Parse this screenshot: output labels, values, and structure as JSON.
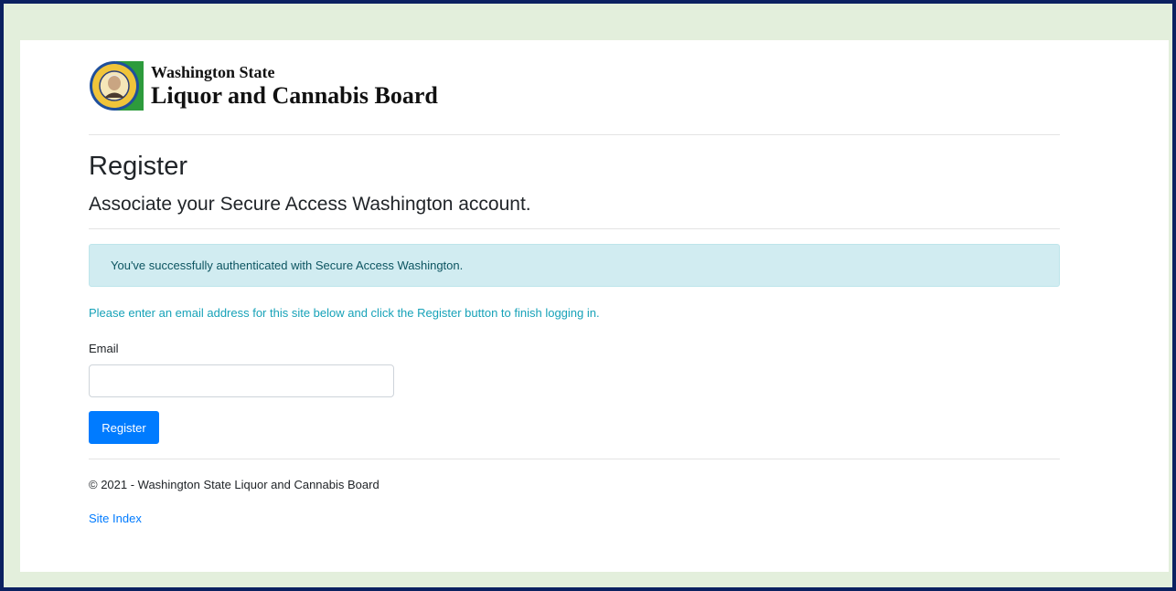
{
  "header": {
    "logo_line1": "Washington State",
    "logo_line2": "Liquor and Cannabis Board"
  },
  "main": {
    "title": "Register",
    "subtitle": "Associate your Secure Access Washington account.",
    "alert_text": "You've successfully authenticated with Secure Access Washington.",
    "info_text": "Please enter an email address for this site below and click the Register button to finish logging in.",
    "email_label": "Email",
    "email_value": "",
    "email_placeholder": "",
    "register_button": "Register"
  },
  "footer": {
    "copyright": "© 2021 - Washington State Liquor and Cannabis Board",
    "site_index_link": "Site Index"
  },
  "colors": {
    "frame_border": "#0b2160",
    "frame_background": "#e3efdc",
    "alert_background": "#d1ecf1",
    "info_text": "#17a2b8",
    "primary_button": "#007bff",
    "logo_green": "#2d9b3c"
  }
}
